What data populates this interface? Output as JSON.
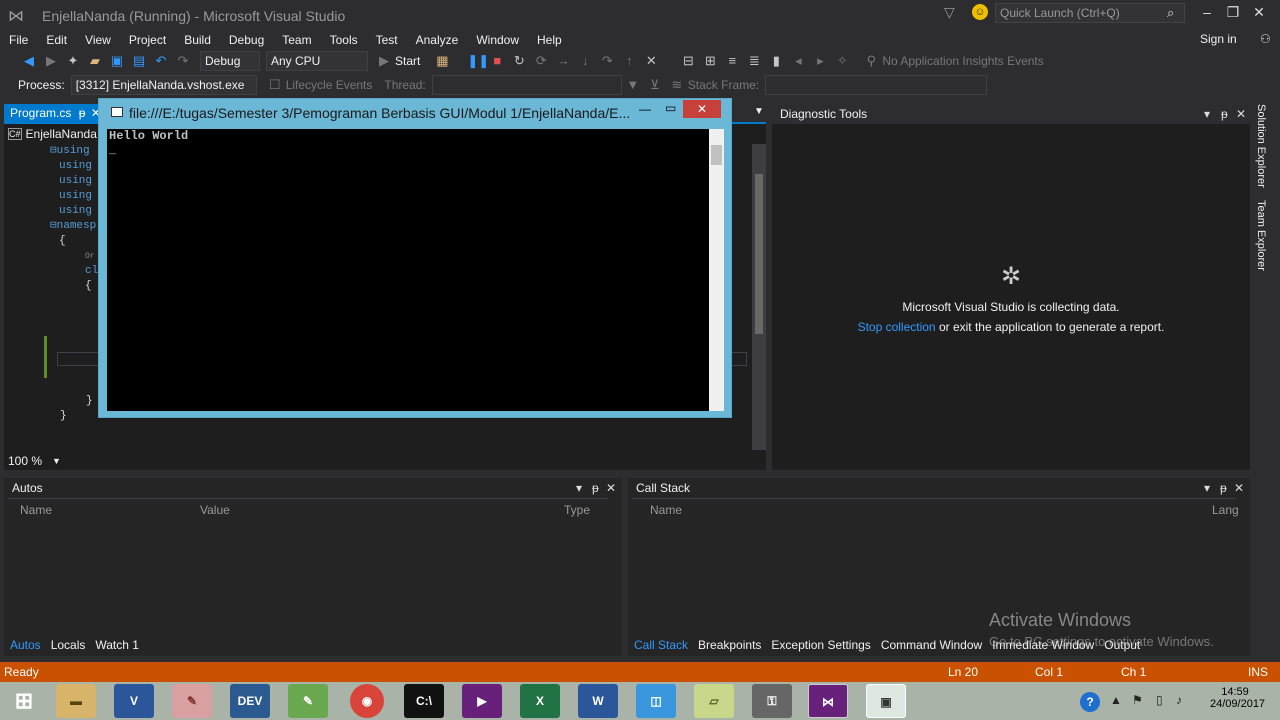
{
  "window": {
    "title": "EnjellaNanda (Running) - Microsoft Visual Studio",
    "quick_launch": "Quick Launch (Ctrl+Q)",
    "sign_in": "Sign in"
  },
  "menu": [
    "File",
    "Edit",
    "View",
    "Project",
    "Build",
    "Debug",
    "Team",
    "Tools",
    "Test",
    "Analyze",
    "Window",
    "Help"
  ],
  "toolbar": {
    "config": "Debug",
    "platform": "Any CPU",
    "start": "Start",
    "insights": "No Application Insights Events"
  },
  "debugbar": {
    "process_label": "Process:",
    "process_value": "[3312] EnjellaNanda.vshost.exe",
    "lifecycle": "Lifecycle Events",
    "thread": "Thread:",
    "stack_frame": "Stack Frame:"
  },
  "editor": {
    "tab": "Program.cs",
    "nav": "EnjellaNanda",
    "zoom": "100 %",
    "lines": [
      "using",
      "using",
      "using",
      "using",
      "using",
      "",
      "namesp",
      "{",
      "Or",
      "cl",
      "{",
      "",
      "",
      "",
      "",
      "}",
      "}"
    ]
  },
  "console": {
    "title": "file:///E:/tugas/Semester 3/Pemograman Berbasis GUI/Modul 1/EnjellaNanda/E...",
    "output": "Hello World",
    "cursor": "_"
  },
  "diagnostic": {
    "title": "Diagnostic Tools",
    "message": "Microsoft Visual Studio is collecting data.",
    "link": "Stop collection",
    "suffix": " or exit the application to generate a report."
  },
  "side_tabs": [
    "Solution Explorer",
    "Team Explorer"
  ],
  "autos": {
    "title": "Autos",
    "columns": [
      "Name",
      "Value",
      "Type"
    ],
    "tabs": [
      "Autos",
      "Locals",
      "Watch 1"
    ]
  },
  "callstack": {
    "title": "Call Stack",
    "columns": [
      "Name",
      "Lang"
    ],
    "tabs": [
      "Call Stack",
      "Breakpoints",
      "Exception Settings",
      "Command Window",
      "Immediate Window",
      "Output"
    ]
  },
  "watermark": {
    "line1": "Activate Windows",
    "line2": "Go to PC settings to activate Windows."
  },
  "status": {
    "ready": "Ready",
    "ln": "Ln 20",
    "col": "Col 1",
    "ch": "Ch 1",
    "ins": "INS"
  },
  "taskbar": {
    "time": "14:59",
    "date": "24/09/2017"
  },
  "colors": {
    "accent": "#007acc",
    "status": "#ca5100",
    "link": "#3399ff"
  }
}
